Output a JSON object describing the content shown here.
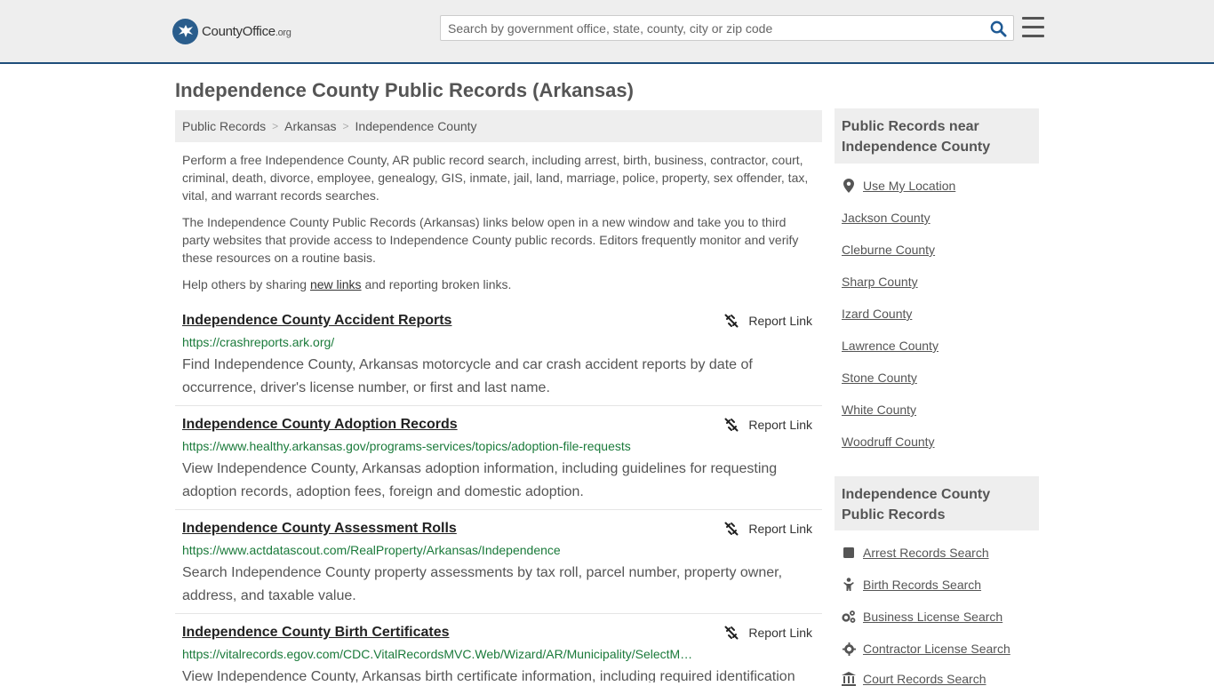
{
  "header": {
    "logo_text": "CountyOffice",
    "logo_tld": ".org",
    "search_placeholder": "Search by government office, state, county, city or zip code"
  },
  "page": {
    "title": "Independence County Public Records (Arkansas)"
  },
  "breadcrumb": [
    "Public Records",
    "Arkansas",
    "Independence County"
  ],
  "intro": {
    "p1": "Perform a free Independence County, AR public record search, including arrest, birth, business, contractor, court, criminal, death, divorce, employee, genealogy, GIS, inmate, jail, land, marriage, police, property, sex offender, tax, vital, and warrant records searches.",
    "p2": "The Independence County Public Records (Arkansas) links below open in a new window and take you to third party websites that provide access to Independence County public records. Editors frequently monitor and verify these resources on a routine basis.",
    "p3_before": "Help others by sharing ",
    "p3_link": "new links",
    "p3_after": " and reporting broken links."
  },
  "report_label": "Report Link",
  "records": [
    {
      "title": "Independence County Accident Reports",
      "url": "https://crashreports.ark.org/",
      "desc": "Find Independence County, Arkansas motorcycle and car crash accident reports by date of occurrence, driver's license number, or first and last name."
    },
    {
      "title": "Independence County Adoption Records",
      "url": "https://www.healthy.arkansas.gov/programs-services/topics/adoption-file-requests",
      "desc": "View Independence County, Arkansas adoption information, including guidelines for requesting adoption records, adoption fees, foreign and domestic adoption."
    },
    {
      "title": "Independence County Assessment Rolls",
      "url": "https://www.actdatascout.com/RealProperty/Arkansas/Independence",
      "desc": "Search Independence County property assessments by tax roll, parcel number, property owner, address, and taxable value."
    },
    {
      "title": "Independence County Birth Certificates",
      "url": "https://vitalrecords.egov.com/CDC.VitalRecordsMVC.Web/Wizard/AR/Municipality/SelectM…",
      "desc": "View Independence County, Arkansas birth certificate information, including required identification"
    }
  ],
  "sidebar": {
    "nearby_heading": "Public Records near Independence County",
    "use_location": "Use My Location",
    "nearby": [
      "Jackson County",
      "Cleburne County",
      "Sharp County",
      "Izard County",
      "Lawrence County",
      "Stone County",
      "White County",
      "Woodruff County"
    ],
    "records_heading": "Independence County Public Records",
    "record_links": [
      {
        "label": "Arrest Records Search",
        "icon": "square-icon"
      },
      {
        "label": "Birth Records Search",
        "icon": "baby-icon"
      },
      {
        "label": "Business License Search",
        "icon": "gears-icon"
      },
      {
        "label": "Contractor License Search",
        "icon": "gear-icon"
      },
      {
        "label": "Court Records Search",
        "icon": "courthouse-icon"
      }
    ]
  }
}
